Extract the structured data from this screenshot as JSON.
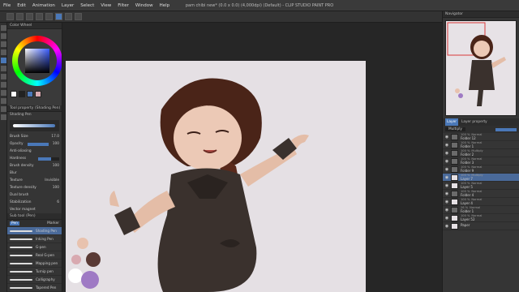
{
  "window": {
    "title": "pam chibi new* (0.0 x 0.0) (4,000dpi) (Default) - CLIP STUDIO PAINT PRO"
  },
  "menu": [
    "File",
    "Edit",
    "Animation",
    "Layer",
    "Select",
    "View",
    "Filter",
    "Window",
    "Help"
  ],
  "left_panel": {
    "color_header": "Color Wheel",
    "tool_property_header": "Tool property (Shading Pen)",
    "tool_name": "Shading Pen",
    "brush_size_label": "Brush Size",
    "brush_size_value": "17.0",
    "opacity_label": "Opacity",
    "opacity_value": "100",
    "anti_alias_label": "Anti-aliasing",
    "hardness_label": "Hardness",
    "brush_density_label": "Brush density",
    "brush_density_value": "100",
    "blur_label": "Blur",
    "texture_label": "Texture",
    "texture_value": "Invisible",
    "texture_density_label": "Texture density",
    "texture_density_value": "100",
    "dual_brush_label": "Dual brush",
    "stabilization_label": "Stabilization",
    "stabilization_value": "6",
    "vector_magnet_label": "Vector magnet",
    "sub_tool_header": "Sub tool (Pen)",
    "sub_tool_tabs": [
      "Pen",
      "Marker"
    ],
    "brushes": [
      "Shading Pen",
      "Inking Pen",
      "G-pen",
      "Real G-pen",
      "Mapping pen",
      "Turnip pen",
      "Calligraphy",
      "Tapered Pen",
      "For effect line"
    ],
    "selected_brush": 0,
    "swatches": [
      "#ffffff",
      "#222222",
      "#4a78b8",
      "#d8a9b0"
    ]
  },
  "right_panel": {
    "navigator_header": "Navigator",
    "layer_tabs": [
      "Layer",
      "Layer property"
    ],
    "blend_mode": "Multiply",
    "layers": [
      {
        "pct": "100 %",
        "mode": "Normal",
        "name": "Folder 12",
        "folder": true,
        "sel": false
      },
      {
        "pct": "100 %",
        "mode": "Normal",
        "name": "Folder 1",
        "folder": true,
        "sel": false
      },
      {
        "pct": "100 %",
        "mode": "Multiply",
        "name": "Folder 2",
        "folder": true,
        "sel": false
      },
      {
        "pct": "100 %",
        "mode": "Normal",
        "name": "Folder 3",
        "folder": true,
        "sel": false
      },
      {
        "pct": "100 %",
        "mode": "Normal",
        "name": "Folder 9",
        "folder": true,
        "sel": false
      },
      {
        "pct": "100 %",
        "mode": "Multiply",
        "name": "Layer 7",
        "folder": false,
        "sel": true
      },
      {
        "pct": "100 %",
        "mode": "Normal",
        "name": "Layer 5",
        "folder": false,
        "sel": false
      },
      {
        "pct": "100 %",
        "mode": "Normal",
        "name": "Folder 4",
        "folder": true,
        "sel": false
      },
      {
        "pct": "100 %",
        "mode": "Normal",
        "name": "Layer 4",
        "folder": false,
        "sel": false
      },
      {
        "pct": "26 %",
        "mode": "Normal",
        "name": "Folder 1",
        "folder": true,
        "sel": false
      },
      {
        "pct": "100 %",
        "mode": "Normal",
        "name": "Layer 52",
        "folder": false,
        "sel": false
      },
      {
        "pct": "",
        "mode": "",
        "name": "Paper",
        "folder": false,
        "sel": false
      }
    ]
  },
  "canvas": {
    "zoom": "25.0"
  }
}
